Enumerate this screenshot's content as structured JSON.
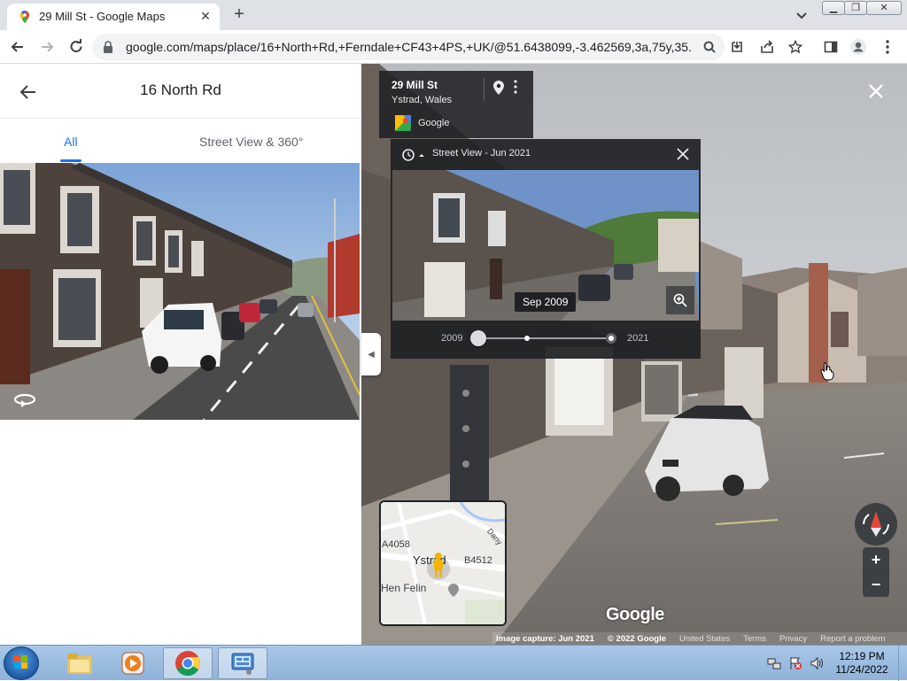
{
  "browser": {
    "tab_title": "29 Mill St - Google Maps",
    "url": "google.com/maps/place/16+North+Rd,+Ferndale+CF43+4PS,+UK/@51.6438099,-3.462569,3a,75y,35...",
    "new_tab_label": "+"
  },
  "left_panel": {
    "title": "16 North Rd",
    "tabs": [
      {
        "label": "All",
        "active": true
      },
      {
        "label": "Street View & 360°",
        "active": false
      }
    ]
  },
  "location_card": {
    "title": "29 Mill St",
    "subtitle": "Ystrad, Wales",
    "provider": "Google"
  },
  "time_machine": {
    "label": "Street View - Jun 2021",
    "selected_date": "Sep 2009",
    "start_year": "2009",
    "end_year": "2021"
  },
  "minimap": {
    "labels": [
      "A4058",
      "Ystrad",
      "B4512",
      "Hen Felin",
      "Dany"
    ]
  },
  "map_footer": {
    "logo": "Google",
    "image_capture": "Image capture: Jun 2021",
    "copyright": "© 2022 Google",
    "links": [
      "United States",
      "Terms",
      "Privacy",
      "Report a problem"
    ]
  },
  "zoom": {
    "plus": "+",
    "minus": "−"
  },
  "taskbar": {
    "time": "12:19 PM",
    "date": "11/24/2022"
  },
  "colors": {
    "accent": "#1a73e8",
    "panel_dark": "#202124"
  }
}
